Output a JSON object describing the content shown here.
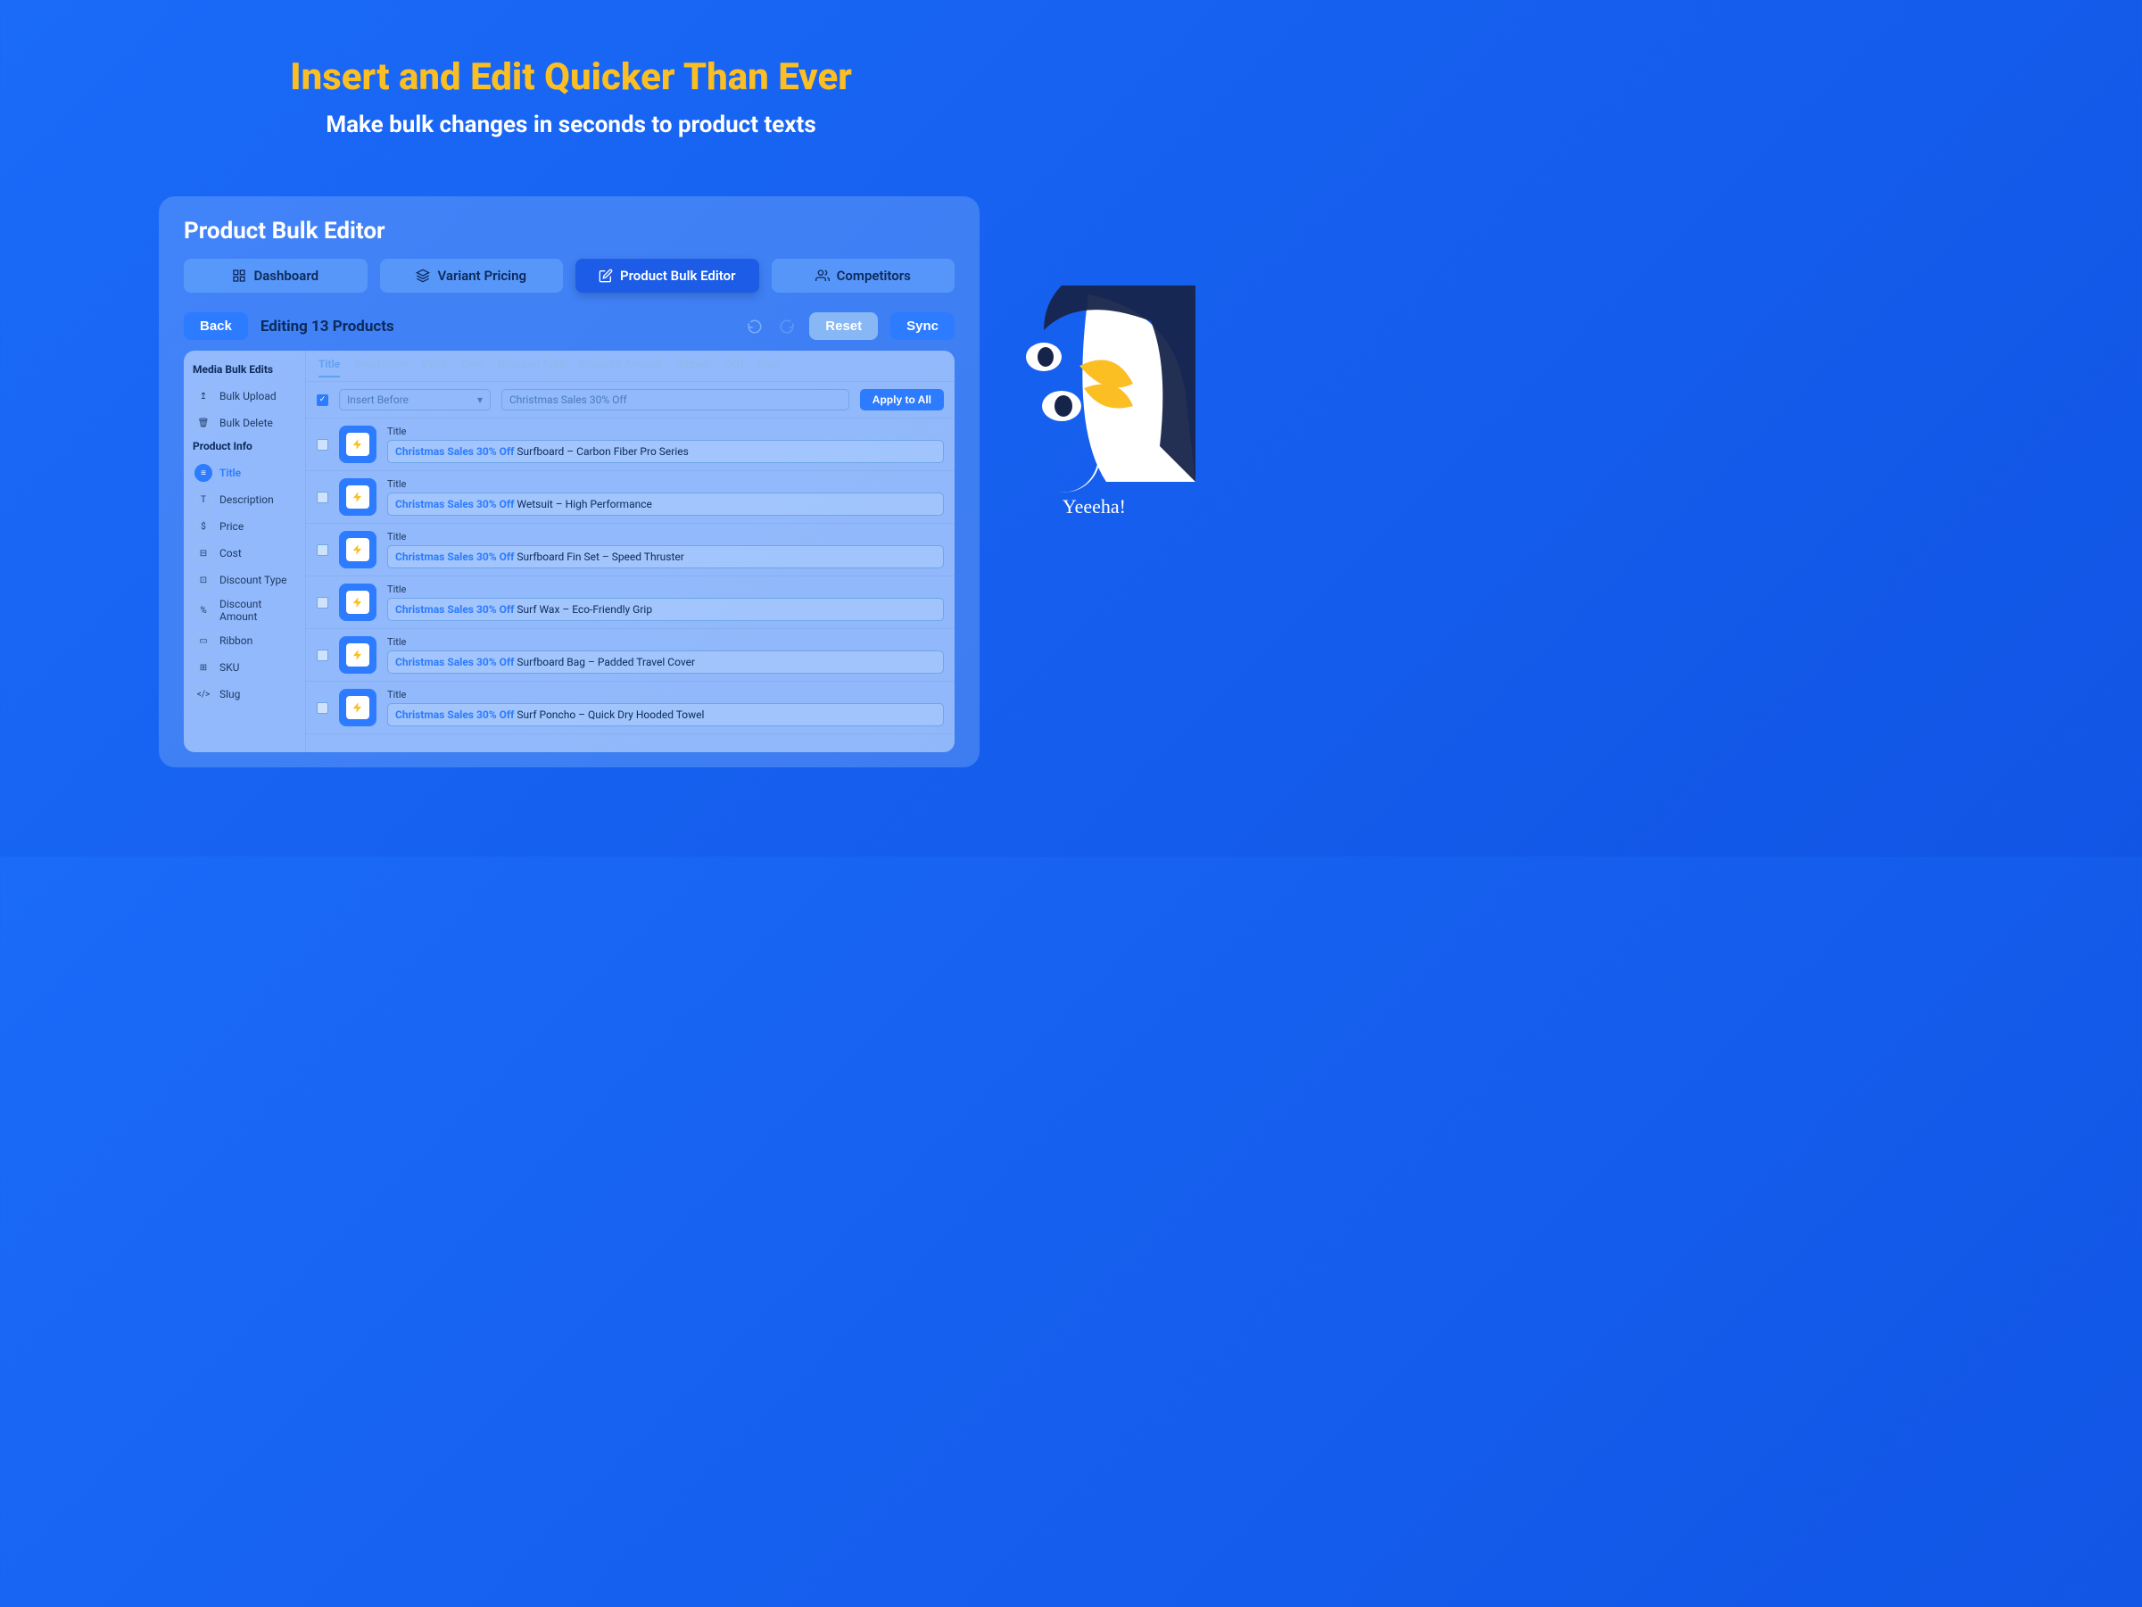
{
  "hero": {
    "title": "Insert and Edit Quicker Than Ever",
    "subtitle": "Make bulk changes in seconds to product texts"
  },
  "card_title": "Product Bulk Editor",
  "tabs": {
    "dashboard": "Dashboard",
    "variant_pricing": "Variant Pricing",
    "product_bulk_editor": "Product Bulk Editor",
    "competitors": "Competitors"
  },
  "toolbar": {
    "back": "Back",
    "editing": "Editing 13 Products",
    "reset": "Reset",
    "sync": "Sync"
  },
  "sidebar": {
    "media_head": "Media Bulk Edits",
    "bulk_upload": "Bulk Upload",
    "bulk_delete": "Bulk Delete",
    "product_head": "Product Info",
    "title": "Title",
    "description": "Description",
    "price": "Price",
    "cost": "Cost",
    "discount_type": "Discount Type",
    "discount_amount": "Discount Amount",
    "ribbon": "Ribbon",
    "sku": "SKU",
    "slug": "Slug"
  },
  "field_tabs": [
    "Title",
    "Description",
    "Price",
    "Cost",
    "Discount Type",
    "Discount Amount",
    "Ribbon",
    "SKU",
    "Slug"
  ],
  "controls": {
    "mode": "Insert Before",
    "text": "Christmas Sales 30% Off",
    "apply": "Apply to All"
  },
  "prefix": "Christmas Sales 30% Off",
  "row_label": "Title",
  "products": [
    "Surfboard – Carbon Fiber Pro Series",
    "Wetsuit – High Performance",
    "Surfboard Fin Set – Speed Thruster",
    "Surf Wax – Eco-Friendly Grip",
    "Surfboard Bag – Padded Travel Cover",
    "Surf Poncho – Quick Dry Hooded Towel"
  ],
  "mascot_exclaim": "Yeeeha!"
}
